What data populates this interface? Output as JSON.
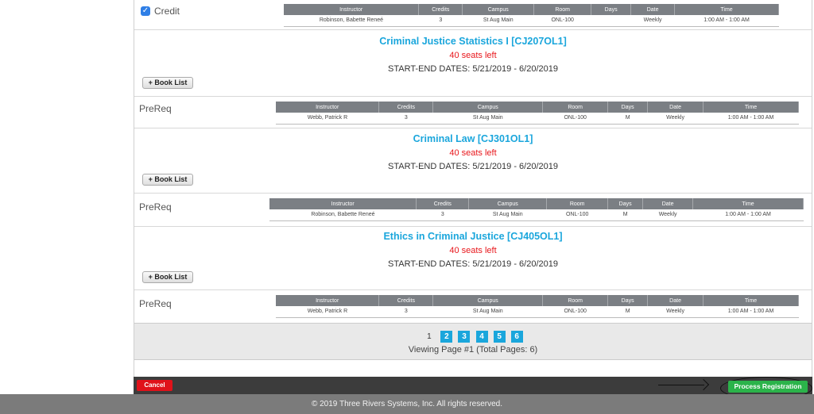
{
  "colors": {
    "accent": "#1aa6dc",
    "seats": "#e8161b",
    "header_gray": "#7b7f84",
    "cancel": "#e0121a",
    "process": "#2bb34a"
  },
  "top_row": {
    "checkbox_label": "Credit",
    "checked": true,
    "headers": [
      "Instructor",
      "Credits",
      "Campus",
      "Room",
      "Days",
      "Date",
      "Time"
    ],
    "cells": [
      "Robinson, Babette Reneé",
      "3",
      "St Aug Main",
      "ONL-100",
      "",
      "Weekly",
      "1:00 AM - 1:00 AM"
    ]
  },
  "courses": [
    {
      "title": "Criminal Justice Statistics I [CJ207OL1]",
      "seats": "40 seats left",
      "dates": "START-END DATES: 5/21/2019 - 6/20/2019",
      "book_list": "+ Book List",
      "prereq_label": "PreReq",
      "headers": [
        "Instructor",
        "Credits",
        "Campus",
        "Room",
        "Days",
        "Date",
        "Time"
      ],
      "cells": [
        "Webb, Patrick R",
        "3",
        "St Aug Main",
        "ONL-100",
        "M",
        "Weekly",
        "1:00 AM - 1:00 AM"
      ]
    },
    {
      "title": "Criminal Law [CJ301OL1]",
      "seats": "40 seats left",
      "dates": "START-END DATES: 5/21/2019 - 6/20/2019",
      "book_list": "+ Book List",
      "prereq_label": "PreReq",
      "headers": [
        "Instructor",
        "Credits",
        "Campus",
        "Room",
        "Days",
        "Date",
        "Time"
      ],
      "cells": [
        "Robinson, Babette Reneé",
        "3",
        "St Aug Main",
        "ONL-100",
        "M",
        "Weekly",
        "1:00 AM - 1:00 AM"
      ]
    },
    {
      "title": "Ethics in Criminal Justice [CJ405OL1]",
      "seats": "40 seats left",
      "dates": "START-END DATES: 5/21/2019 - 6/20/2019",
      "book_list": "+ Book List",
      "prereq_label": "PreReq",
      "headers": [
        "Instructor",
        "Credits",
        "Campus",
        "Room",
        "Days",
        "Date",
        "Time"
      ],
      "cells": [
        "Webb, Patrick R",
        "3",
        "St Aug Main",
        "ONL-100",
        "M",
        "Weekly",
        "1:00 AM - 1:00 AM"
      ]
    }
  ],
  "pagination": {
    "current": "1",
    "pages": [
      "2",
      "3",
      "4",
      "5",
      "6"
    ],
    "summary": "Viewing Page #1 (Total Pages: 6)"
  },
  "actions": {
    "cancel": "Cancel",
    "process": "Process Registration"
  },
  "footer": {
    "copyright": "© 2019 Three Rivers Systems, Inc. All rights reserved."
  }
}
